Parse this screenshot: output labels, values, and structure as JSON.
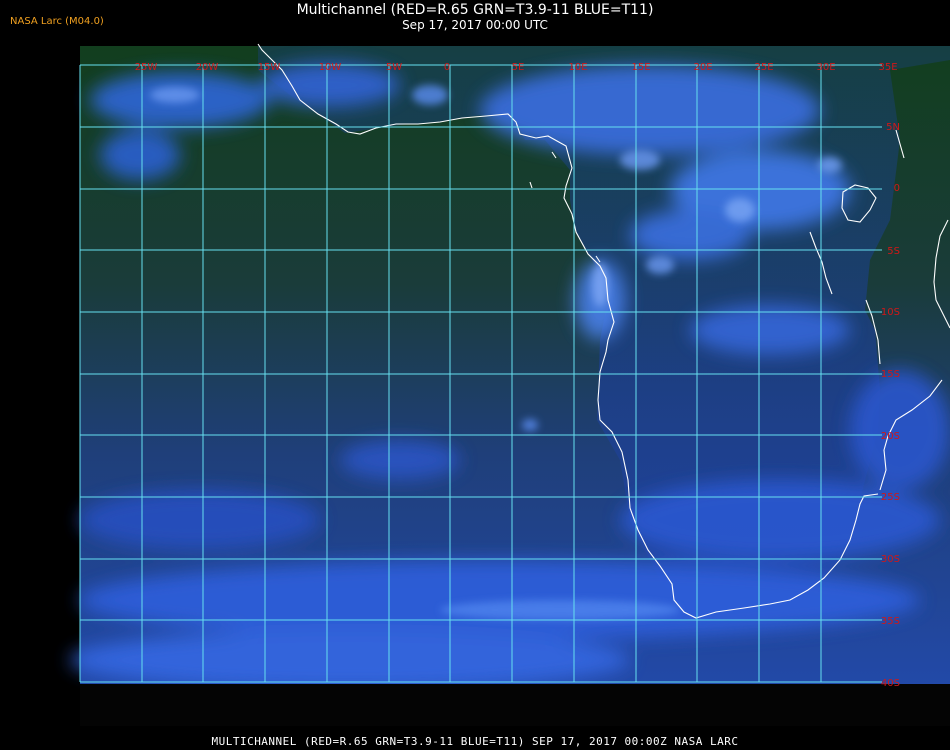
{
  "header": {
    "brand": "NASA Larc (M04.0)",
    "title": "Multichannel (RED=R.65 GRN=T3.9-11 BLUE=T11)",
    "subtitle": "Sep 17, 2017 00:00 UTC"
  },
  "footer": "MULTICHANNEL (RED=R.65 GRN=T3.9-11 BLUE=T11) SEP 17, 2017 00:00Z   NASA LARC",
  "map": {
    "longitude_labels": [
      "25W",
      "20W",
      "15W",
      "10W",
      "5W",
      "0",
      "5E",
      "10E",
      "15E",
      "20E",
      "25E",
      "30E",
      "35E"
    ],
    "latitude_labels": [
      "5N",
      "0",
      "5S",
      "10S",
      "15S",
      "20S",
      "25S",
      "30S",
      "35S",
      "40S"
    ],
    "colors": {
      "background": "#000000",
      "grid": "#66e0f0",
      "coastline": "#ffffff",
      "labels": "#d01818",
      "ocean_dark": "#0e3e1a",
      "cloud_blue": "#2f5fe0",
      "cloud_light": "#5a8cf0"
    }
  }
}
